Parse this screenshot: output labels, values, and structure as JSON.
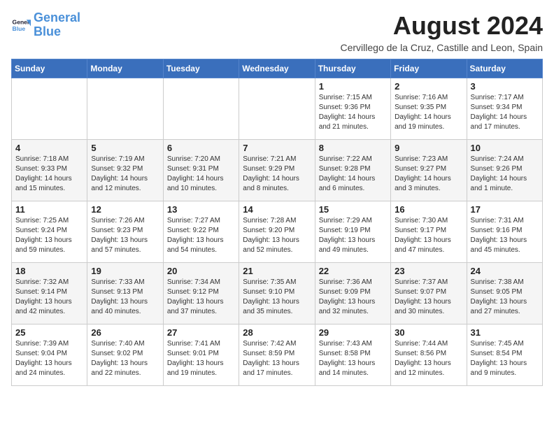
{
  "header": {
    "logo_line1": "General",
    "logo_line2": "Blue",
    "month_year": "August 2024",
    "location": "Cervillego de la Cruz, Castille and Leon, Spain"
  },
  "days_of_week": [
    "Sunday",
    "Monday",
    "Tuesday",
    "Wednesday",
    "Thursday",
    "Friday",
    "Saturday"
  ],
  "weeks": [
    [
      {
        "day": "",
        "info": ""
      },
      {
        "day": "",
        "info": ""
      },
      {
        "day": "",
        "info": ""
      },
      {
        "day": "",
        "info": ""
      },
      {
        "day": "1",
        "info": "Sunrise: 7:15 AM\nSunset: 9:36 PM\nDaylight: 14 hours\nand 21 minutes."
      },
      {
        "day": "2",
        "info": "Sunrise: 7:16 AM\nSunset: 9:35 PM\nDaylight: 14 hours\nand 19 minutes."
      },
      {
        "day": "3",
        "info": "Sunrise: 7:17 AM\nSunset: 9:34 PM\nDaylight: 14 hours\nand 17 minutes."
      }
    ],
    [
      {
        "day": "4",
        "info": "Sunrise: 7:18 AM\nSunset: 9:33 PM\nDaylight: 14 hours\nand 15 minutes."
      },
      {
        "day": "5",
        "info": "Sunrise: 7:19 AM\nSunset: 9:32 PM\nDaylight: 14 hours\nand 12 minutes."
      },
      {
        "day": "6",
        "info": "Sunrise: 7:20 AM\nSunset: 9:31 PM\nDaylight: 14 hours\nand 10 minutes."
      },
      {
        "day": "7",
        "info": "Sunrise: 7:21 AM\nSunset: 9:29 PM\nDaylight: 14 hours\nand 8 minutes."
      },
      {
        "day": "8",
        "info": "Sunrise: 7:22 AM\nSunset: 9:28 PM\nDaylight: 14 hours\nand 6 minutes."
      },
      {
        "day": "9",
        "info": "Sunrise: 7:23 AM\nSunset: 9:27 PM\nDaylight: 14 hours\nand 3 minutes."
      },
      {
        "day": "10",
        "info": "Sunrise: 7:24 AM\nSunset: 9:26 PM\nDaylight: 14 hours\nand 1 minute."
      }
    ],
    [
      {
        "day": "11",
        "info": "Sunrise: 7:25 AM\nSunset: 9:24 PM\nDaylight: 13 hours\nand 59 minutes."
      },
      {
        "day": "12",
        "info": "Sunrise: 7:26 AM\nSunset: 9:23 PM\nDaylight: 13 hours\nand 57 minutes."
      },
      {
        "day": "13",
        "info": "Sunrise: 7:27 AM\nSunset: 9:22 PM\nDaylight: 13 hours\nand 54 minutes."
      },
      {
        "day": "14",
        "info": "Sunrise: 7:28 AM\nSunset: 9:20 PM\nDaylight: 13 hours\nand 52 minutes."
      },
      {
        "day": "15",
        "info": "Sunrise: 7:29 AM\nSunset: 9:19 PM\nDaylight: 13 hours\nand 49 minutes."
      },
      {
        "day": "16",
        "info": "Sunrise: 7:30 AM\nSunset: 9:17 PM\nDaylight: 13 hours\nand 47 minutes."
      },
      {
        "day": "17",
        "info": "Sunrise: 7:31 AM\nSunset: 9:16 PM\nDaylight: 13 hours\nand 45 minutes."
      }
    ],
    [
      {
        "day": "18",
        "info": "Sunrise: 7:32 AM\nSunset: 9:14 PM\nDaylight: 13 hours\nand 42 minutes."
      },
      {
        "day": "19",
        "info": "Sunrise: 7:33 AM\nSunset: 9:13 PM\nDaylight: 13 hours\nand 40 minutes."
      },
      {
        "day": "20",
        "info": "Sunrise: 7:34 AM\nSunset: 9:12 PM\nDaylight: 13 hours\nand 37 minutes."
      },
      {
        "day": "21",
        "info": "Sunrise: 7:35 AM\nSunset: 9:10 PM\nDaylight: 13 hours\nand 35 minutes."
      },
      {
        "day": "22",
        "info": "Sunrise: 7:36 AM\nSunset: 9:09 PM\nDaylight: 13 hours\nand 32 minutes."
      },
      {
        "day": "23",
        "info": "Sunrise: 7:37 AM\nSunset: 9:07 PM\nDaylight: 13 hours\nand 30 minutes."
      },
      {
        "day": "24",
        "info": "Sunrise: 7:38 AM\nSunset: 9:05 PM\nDaylight: 13 hours\nand 27 minutes."
      }
    ],
    [
      {
        "day": "25",
        "info": "Sunrise: 7:39 AM\nSunset: 9:04 PM\nDaylight: 13 hours\nand 24 minutes."
      },
      {
        "day": "26",
        "info": "Sunrise: 7:40 AM\nSunset: 9:02 PM\nDaylight: 13 hours\nand 22 minutes."
      },
      {
        "day": "27",
        "info": "Sunrise: 7:41 AM\nSunset: 9:01 PM\nDaylight: 13 hours\nand 19 minutes."
      },
      {
        "day": "28",
        "info": "Sunrise: 7:42 AM\nSunset: 8:59 PM\nDaylight: 13 hours\nand 17 minutes."
      },
      {
        "day": "29",
        "info": "Sunrise: 7:43 AM\nSunset: 8:58 PM\nDaylight: 13 hours\nand 14 minutes."
      },
      {
        "day": "30",
        "info": "Sunrise: 7:44 AM\nSunset: 8:56 PM\nDaylight: 13 hours\nand 12 minutes."
      },
      {
        "day": "31",
        "info": "Sunrise: 7:45 AM\nSunset: 8:54 PM\nDaylight: 13 hours\nand 9 minutes."
      }
    ]
  ]
}
